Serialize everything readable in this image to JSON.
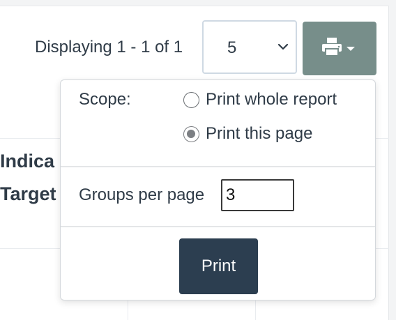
{
  "pagination": {
    "display_text": "Displaying 1 - 1 of 1",
    "page_size_value": "5"
  },
  "print_menu": {
    "button_icon": "printer-icon",
    "scope_label": "Scope:",
    "options": [
      {
        "label": "Print whole report",
        "checked": false
      },
      {
        "label": "Print this page",
        "checked": true
      }
    ],
    "groups_label": "Groups per page",
    "groups_value": "3",
    "print_label": "Print"
  },
  "table": {
    "headers": [
      "Indica",
      "Target"
    ]
  },
  "colors": {
    "print_menu_button": "#778e8a",
    "print_button": "#2c3e50",
    "text": "#2f3b47"
  }
}
